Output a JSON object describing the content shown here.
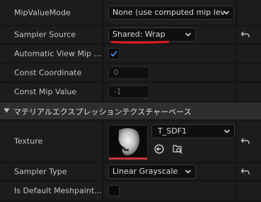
{
  "rows": {
    "mip_value_mode": {
      "label": "MipValueMode",
      "value": "None (use computed mip lev"
    },
    "sampler_source": {
      "label": "Sampler Source",
      "value": "Shared: Wrap"
    },
    "auto_view_mip": {
      "label": "Automatic View Mip Bi...",
      "checked": true
    },
    "const_coordinate": {
      "label": "Const Coordinate",
      "value": "0"
    },
    "const_mip_value": {
      "label": "Const Mip Value",
      "value": "-1"
    },
    "texture": {
      "label": "Texture",
      "value": "T_SDF1"
    },
    "sampler_type": {
      "label": "Sampler Type",
      "value": "Linear Grayscale"
    },
    "default_meshpaint": {
      "label": "Is Default Meshpaint...",
      "checked": false
    }
  },
  "section": {
    "title": "マテリアルエクスプレッションテクスチャーベース"
  },
  "colors": {
    "accent_check": "#4f8de0",
    "annotation_red": "#e01919",
    "thumb_bar": "#c2363c"
  },
  "icons": [
    "chevron-down-icon",
    "reset-arrow-icon",
    "checkmark-icon",
    "collapse-triangle-icon",
    "use-selected-asset-icon",
    "browse-asset-icon"
  ]
}
